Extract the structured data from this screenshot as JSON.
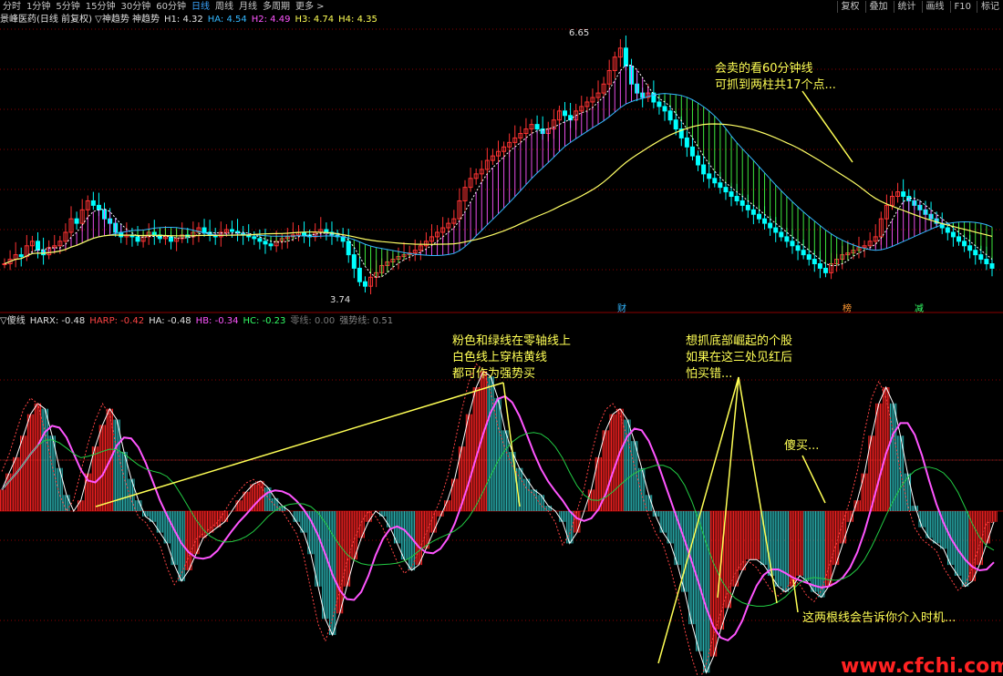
{
  "toolbar": {
    "periods": [
      "分时",
      "1分钟",
      "5分钟",
      "15分钟",
      "30分钟",
      "60分钟",
      "日线",
      "周线",
      "月线",
      "多周期",
      "更多 >"
    ],
    "active": "日线",
    "right_buttons": [
      "复权",
      "叠加",
      "统计",
      "画线",
      "F10",
      "标记"
    ]
  },
  "main_legend": {
    "prefix": "景峰医药(日线 前复权) ▽神趋势  神趋势",
    "items": [
      {
        "text": "H1: 4.32",
        "color": "#e0e0e0"
      },
      {
        "text": "HA: 4.54",
        "color": "#33b7ff"
      },
      {
        "text": "H2: 4.49",
        "color": "#ff55ff"
      },
      {
        "text": "H3: 4.74",
        "color": "#ffff55"
      },
      {
        "text": "H4: 4.35",
        "color": "#ffff55"
      }
    ]
  },
  "ind_legend": {
    "prefix": "▽傻线",
    "items": [
      {
        "text": "HARX: -0.48",
        "color": "#e0e0e0"
      },
      {
        "text": "HARP: -0.42",
        "color": "#ff4444"
      },
      {
        "text": "HA: -0.48",
        "color": "#e0e0e0"
      },
      {
        "text": "HB: -0.34",
        "color": "#ff55ff"
      },
      {
        "text": "HC: -0.23",
        "color": "#33ff66"
      },
      {
        "text": "零线: 0.00",
        "color": "#777777"
      },
      {
        "text": "强势线: 0.51",
        "color": "#888888"
      }
    ]
  },
  "price_labels": {
    "high": "6.65",
    "low": "3.74"
  },
  "markers": [
    {
      "text": "财",
      "color": "#33b7ff"
    },
    {
      "text": "榜",
      "color": "#ff9933"
    },
    {
      "text": "减",
      "color": "#33ff66"
    }
  ],
  "annotations": {
    "a1": [
      "会卖的看60分钟线",
      "可抓到两柱共17个点..."
    ],
    "a2": [
      "粉色和绿线在零轴线上",
      "白色线上穿桔黄线",
      "都可作为强势买"
    ],
    "a3": [
      "想抓底部崛起的个股",
      "如果在这三处见红后",
      "怕买错..."
    ],
    "a4": "傻买...",
    "a5": "这两根线会告诉你介入时机...",
    "watermark": "www.cfchi.com"
  },
  "colors": {
    "up": "#ff3333",
    "down": "#00ffff",
    "pink": "#ff55ff",
    "green": "#44ff44",
    "blue": "#33b7ff",
    "yellow": "#ffff66",
    "orange": "#ffcc33",
    "grid": "#8b0000",
    "annot": "#ffff55",
    "watermark": "#ff2222",
    "hist_up": "#ff2222",
    "hist_down": "#2ab3b3"
  },
  "chart_data": [
    {
      "type": "candlestick",
      "title": "景峰医药(日线 前复权)",
      "price_high": 6.65,
      "price_low": 3.74,
      "close": [
        4.1,
        4.15,
        4.2,
        4.18,
        4.3,
        4.35,
        4.25,
        4.2,
        4.28,
        4.3,
        4.35,
        4.45,
        4.6,
        4.55,
        4.7,
        4.8,
        4.75,
        4.7,
        4.6,
        4.55,
        4.45,
        4.4,
        4.42,
        4.4,
        4.35,
        4.4,
        4.45,
        4.42,
        4.38,
        4.4,
        4.35,
        4.38,
        4.42,
        4.4,
        4.45,
        4.5,
        4.45,
        4.42,
        4.4,
        4.45,
        4.48,
        4.46,
        4.44,
        4.42,
        4.4,
        4.38,
        4.35,
        4.32,
        4.3,
        4.35,
        4.38,
        4.4,
        4.42,
        4.45,
        4.42,
        4.4,
        4.45,
        4.48,
        4.45,
        4.42,
        4.4,
        4.35,
        4.2,
        4.05,
        3.9,
        3.85,
        3.95,
        4.0,
        4.08,
        4.12,
        4.15,
        4.18,
        4.2,
        4.22,
        4.25,
        4.3,
        4.35,
        4.4,
        4.45,
        4.5,
        4.55,
        4.6,
        4.8,
        4.95,
        5.05,
        5.1,
        5.15,
        5.25,
        5.3,
        5.35,
        5.4,
        5.45,
        5.5,
        5.55,
        5.6,
        5.65,
        5.6,
        5.55,
        5.6,
        5.7,
        5.8,
        5.75,
        5.7,
        5.8,
        5.85,
        5.9,
        5.95,
        6.0,
        6.1,
        6.25,
        6.4,
        6.5,
        6.3,
        6.1,
        6.0,
        5.95,
        6.0,
        5.9,
        5.85,
        5.8,
        5.7,
        5.6,
        5.5,
        5.4,
        5.3,
        5.2,
        5.1,
        5.05,
        5.0,
        4.95,
        4.9,
        4.85,
        4.8,
        4.75,
        4.7,
        4.65,
        4.6,
        4.55,
        4.5,
        4.45,
        4.4,
        4.35,
        4.3,
        4.25,
        4.2,
        4.15,
        4.1,
        4.05,
        4.0,
        4.1,
        4.15,
        4.2,
        4.22,
        4.25,
        4.28,
        4.3,
        4.35,
        4.4,
        4.6,
        4.75,
        4.85,
        4.9,
        4.85,
        4.8,
        4.75,
        4.7,
        4.65,
        4.6,
        4.55,
        4.5,
        4.45,
        4.4,
        4.35,
        4.3,
        4.25,
        4.2,
        4.15,
        4.1,
        4.05
      ]
    },
    {
      "type": "bar",
      "title": "傻线",
      "ylim": [
        -1.7,
        1.7
      ],
      "values": [
        0.2,
        0.35,
        0.5,
        0.7,
        0.9,
        1.0,
        0.95,
        0.7,
        0.4,
        0.15,
        0.0,
        0.1,
        0.35,
        0.6,
        0.8,
        0.95,
        0.85,
        0.55,
        0.3,
        0.1,
        -0.05,
        -0.1,
        -0.2,
        -0.3,
        -0.5,
        -0.65,
        -0.55,
        -0.4,
        -0.25,
        -0.2,
        -0.15,
        -0.1,
        0.0,
        0.1,
        0.18,
        0.25,
        0.28,
        0.22,
        0.12,
        0.05,
        0.0,
        -0.1,
        -0.2,
        -0.4,
        -0.7,
        -1.0,
        -1.15,
        -0.95,
        -0.7,
        -0.45,
        -0.25,
        -0.1,
        0.0,
        -0.05,
        -0.15,
        -0.3,
        -0.45,
        -0.55,
        -0.5,
        -0.35,
        -0.2,
        -0.05,
        0.1,
        0.3,
        0.6,
        0.9,
        1.15,
        1.3,
        1.25,
        1.05,
        0.75,
        0.55,
        0.4,
        0.3,
        0.2,
        0.15,
        0.05,
        0.0,
        -0.1,
        -0.3,
        -0.2,
        0.0,
        0.2,
        0.5,
        0.75,
        0.9,
        0.95,
        0.85,
        0.65,
        0.4,
        0.15,
        -0.05,
        -0.2,
        -0.3,
        -0.5,
        -0.75,
        -1.05,
        -1.3,
        -1.5,
        -1.35,
        -1.1,
        -0.9,
        -0.7,
        -0.55,
        -0.45,
        -0.45,
        -0.5,
        -0.6,
        -0.7,
        -0.75,
        -0.7,
        -0.6,
        -0.65,
        -0.75,
        -0.8,
        -0.7,
        -0.5,
        -0.3,
        -0.1,
        0.1,
        0.35,
        0.7,
        1.0,
        1.15,
        1.0,
        0.7,
        0.35,
        0.05,
        -0.15,
        -0.25,
        -0.3,
        -0.35,
        -0.5,
        -0.6,
        -0.7,
        -0.65,
        -0.5,
        -0.3,
        -0.1
      ]
    }
  ]
}
